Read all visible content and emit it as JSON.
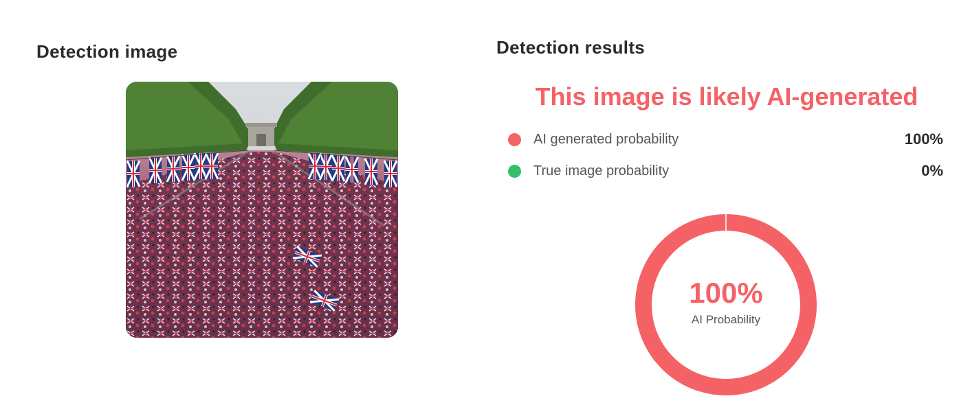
{
  "left_panel": {
    "title": "Detection image"
  },
  "right_panel": {
    "title": "Detection results",
    "verdict": "This image is likely AI-generated",
    "rows": [
      {
        "label": "AI generated probability",
        "value": "100%",
        "color": "#f56266"
      },
      {
        "label": "True image probability",
        "value": "0%",
        "color": "#33c06a"
      }
    ],
    "gauge": {
      "value_text": "100%",
      "label": "AI Probability",
      "fraction": 1.0,
      "color": "#f56266"
    }
  }
}
